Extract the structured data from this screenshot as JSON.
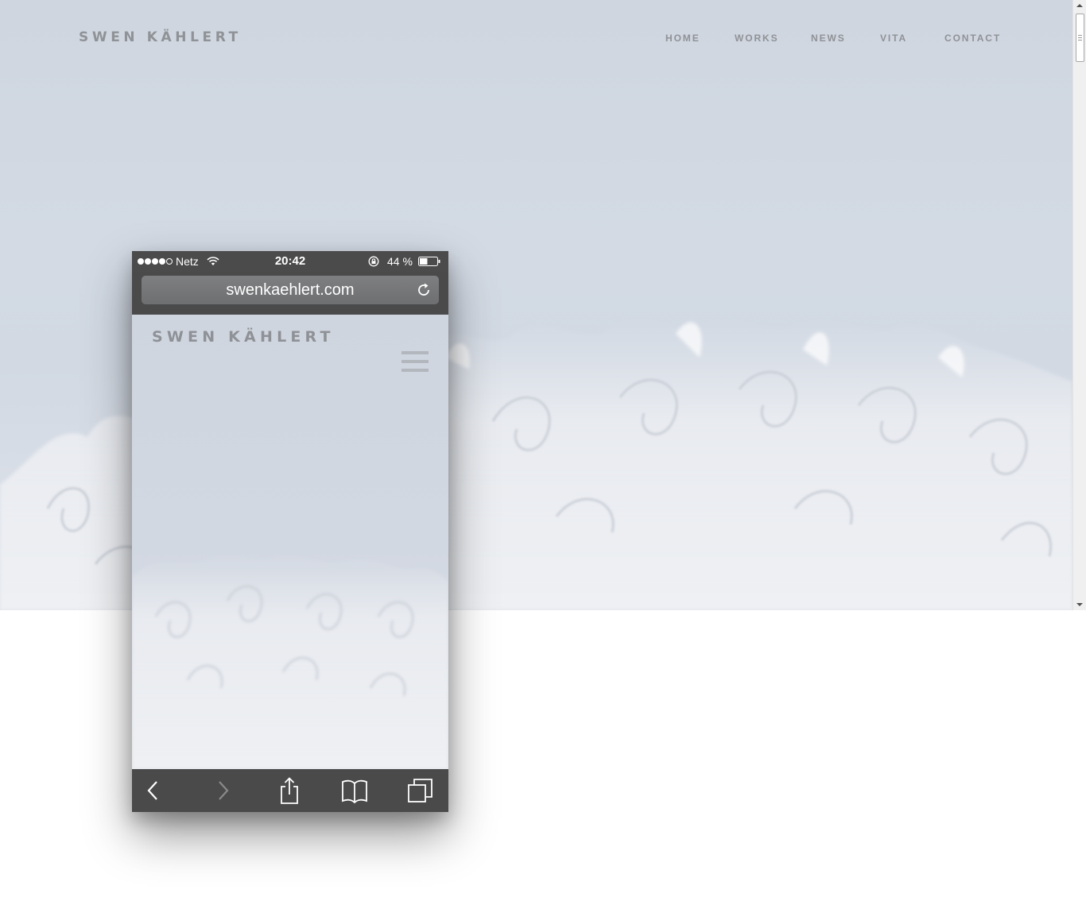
{
  "site": {
    "title": "SWEN KÄHLERT"
  },
  "nav": {
    "items": [
      {
        "label": "HOME"
      },
      {
        "label": "WORKS"
      },
      {
        "label": "NEWS"
      },
      {
        "label": "VITA"
      },
      {
        "label": "CONTACT"
      }
    ]
  },
  "phone": {
    "status": {
      "carrier": "Netz",
      "time": "20:42",
      "battery": "44 %",
      "signal_bars_filled": 4,
      "signal_bars_total": 5
    },
    "browser": {
      "url": "swenkaehlert.com"
    },
    "page": {
      "title": "SWEN KÄHLERT"
    },
    "toolbar": {
      "icons": [
        "back-icon",
        "forward-icon",
        "share-icon",
        "bookmarks-icon",
        "tabs-icon"
      ]
    }
  },
  "colors": {
    "hero_background": "#d2d9e3",
    "nav_text": "#8f9296",
    "phone_chrome": "#4a4a4b",
    "porcelain": "#f4f5f7"
  }
}
